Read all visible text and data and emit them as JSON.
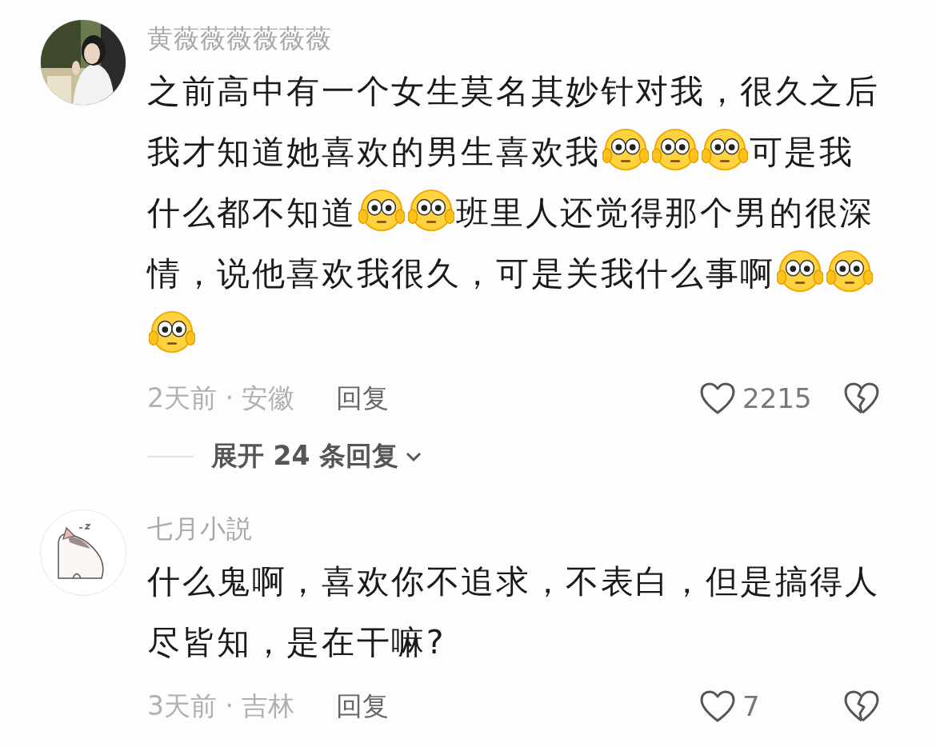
{
  "comments": [
    {
      "username": "黄薇薇薇薇薇薇",
      "content": [
        {
          "kind": "text",
          "text": "之前高中有一个女生莫名其妙针对我，很久之后我才知道她喜欢的男生喜欢我"
        },
        {
          "kind": "emoji"
        },
        {
          "kind": "emoji"
        },
        {
          "kind": "emoji"
        },
        {
          "kind": "text",
          "text": "可是我什么都不知道"
        },
        {
          "kind": "emoji"
        },
        {
          "kind": "emoji"
        },
        {
          "kind": "text",
          "text": "班里人还觉得那个男的很深情，说他喜欢我很久，可是关我什么事啊"
        },
        {
          "kind": "emoji"
        },
        {
          "kind": "emoji"
        },
        {
          "kind": "emoji"
        }
      ],
      "meta": "2天前 · 安徽",
      "reply": "回复",
      "likes": "2215",
      "replies": {
        "label": "展开 24 条回复"
      }
    },
    {
      "username": "七月小説",
      "avatar": {
        "kind": "drawing"
      },
      "content": [
        {
          "kind": "text",
          "text": "什么鬼啊，喜欢你不追求，不表白，但是搞得人尽皆知，是在干嘛?"
        }
      ],
      "meta": "3天前 · 吉林",
      "reply": "回复",
      "likes": "7"
    }
  ]
}
